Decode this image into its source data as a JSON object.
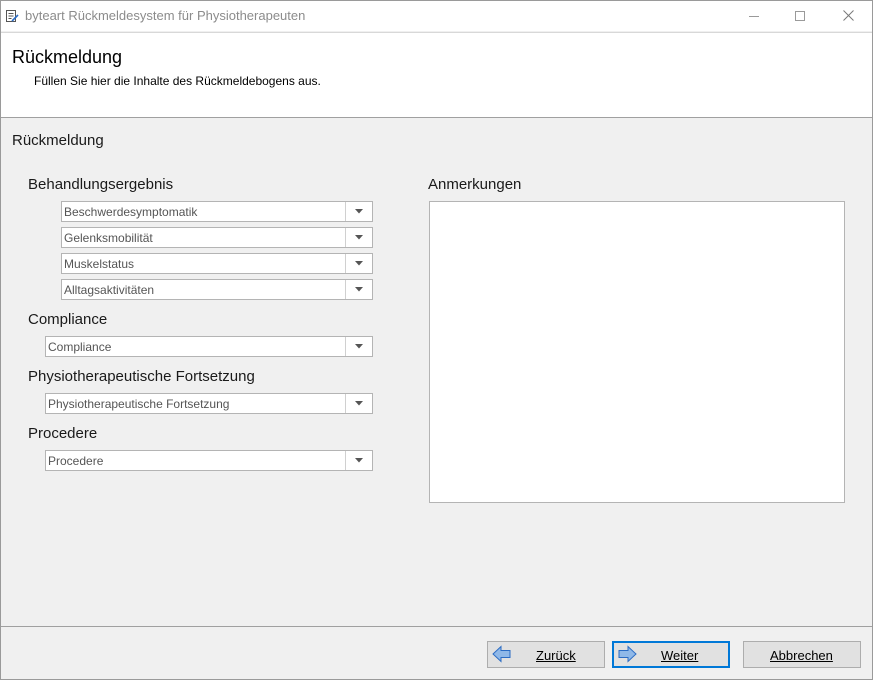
{
  "window": {
    "title": "byteart Rückmeldesystem für Physiotherapeuten",
    "minimize_icon": "minimize-icon",
    "maximize_icon": "maximize-icon",
    "close_icon": "close-icon"
  },
  "header": {
    "title": "Rückmeldung",
    "subtitle": "Füllen Sie hier die Inhalte des Rückmeldebogens aus."
  },
  "main": {
    "section_title": "Rückmeldung",
    "groups": {
      "behandlungsergebnis": {
        "label": "Behandlungsergebnis",
        "combos": [
          "Beschwerdesymptomatik",
          "Gelenksmobilität",
          "Muskelstatus",
          "Alltagsaktivitäten"
        ]
      },
      "compliance": {
        "label": "Compliance",
        "combo": "Compliance"
      },
      "fortsetzung": {
        "label": "Physiotherapeutische Fortsetzung",
        "combo": "Physiotherapeutische Fortsetzung"
      },
      "procedere": {
        "label": "Procedere",
        "combo": "Procedere"
      }
    },
    "notes_label": "Anmerkungen",
    "notes_value": ""
  },
  "footer": {
    "back_label": "Zurück",
    "next_label": "Weiter",
    "cancel_label": "Abbrechen"
  },
  "colors": {
    "accent": "#0078d7",
    "arrow_fill": "#8fb8e8",
    "arrow_stroke": "#2b6cc4"
  }
}
